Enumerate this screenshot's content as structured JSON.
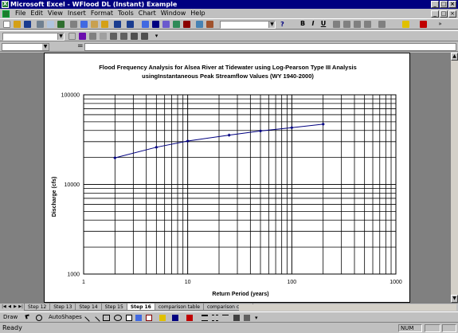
{
  "window": {
    "title": "Microsoft Excel - WFlood DL (Instant) Example",
    "app_icon": "X",
    "buttons": {
      "minimize": "_",
      "maximize": "□",
      "close": "×"
    }
  },
  "menu": {
    "items": [
      "File",
      "Edit",
      "View",
      "Insert",
      "Format",
      "Tools",
      "Chart",
      "Window",
      "Help"
    ]
  },
  "toolbar": {
    "zoom_button": "?",
    "format_buttons": {
      "bold": "B",
      "italic": "I",
      "underline": "U"
    }
  },
  "formula_bar": {
    "name_box": "",
    "eq_sign": "=",
    "content": ""
  },
  "chart_data": {
    "type": "line",
    "title_line1": "Flood Frequency Analysis for Alsea River at Tidewater using Log-Pearson Type III Analysis",
    "title_line2": "usingInstantaneous Peak Streamflow Values (WY 1940-2000)",
    "xlabel": "Return Period (years)",
    "ylabel": "Discharge (cfs)",
    "x_scale": "log",
    "y_scale": "log",
    "xlim": [
      1,
      1000
    ],
    "ylim": [
      1000,
      100000
    ],
    "x_tick_labels": [
      "1",
      "10",
      "100",
      "1000"
    ],
    "y_tick_labels": [
      "100000",
      "10000",
      "1000"
    ],
    "grid": true,
    "legend": "none",
    "series": [
      {
        "x": [
          2,
          5,
          10,
          25,
          50,
          100,
          200
        ],
        "y": [
          19800,
          26000,
          30500,
          35500,
          39500,
          43000,
          47000
        ],
        "color": "#000080"
      }
    ]
  },
  "sheet_tabs": {
    "items": [
      "Step 12",
      "Step 13",
      "Step 14",
      "Step 15",
      "Step 16",
      "comparison table",
      "comparison chart"
    ],
    "active": "Step 16"
  },
  "drawing_toolbar": {
    "draw_label": "Draw",
    "autoshapes_label": "AutoShapes"
  },
  "status": {
    "text": "Ready",
    "num": "NUM"
  }
}
